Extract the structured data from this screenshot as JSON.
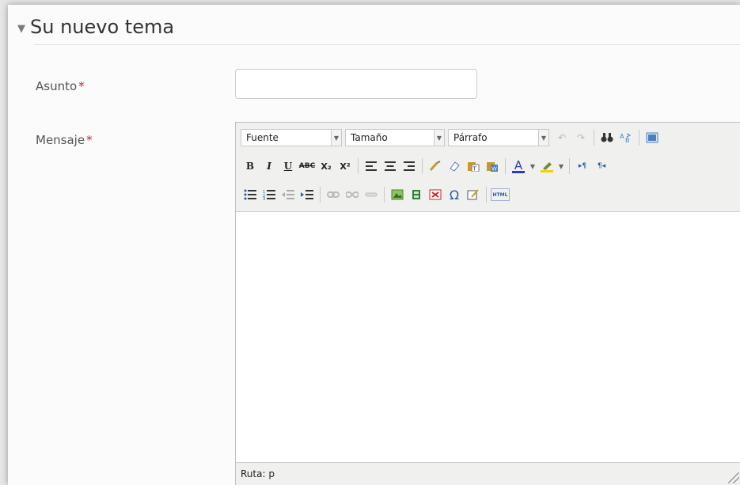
{
  "section": {
    "title": "Su nuevo tema"
  },
  "fields": {
    "subject": {
      "label": "Asunto",
      "value": ""
    },
    "message": {
      "label": "Mensaje"
    },
    "required_mark": "*"
  },
  "editor": {
    "selects": {
      "font": "Fuente",
      "size": "Tamaño",
      "format": "Párrafo"
    },
    "buttons": {
      "bold": "B",
      "italic": "I",
      "underline": "U",
      "strikethrough": "ABC",
      "subscript": "X₂",
      "superscript": "X²",
      "special_char": "Ω",
      "html": "HTML",
      "ltr": "▸¶",
      "rtl": "¶◂"
    },
    "status": {
      "path": "Ruta: p"
    }
  },
  "colors": {
    "required": "#c8242b",
    "text_color_underline": "#2b3fa8",
    "highlight_underline": "#e8d21a"
  }
}
